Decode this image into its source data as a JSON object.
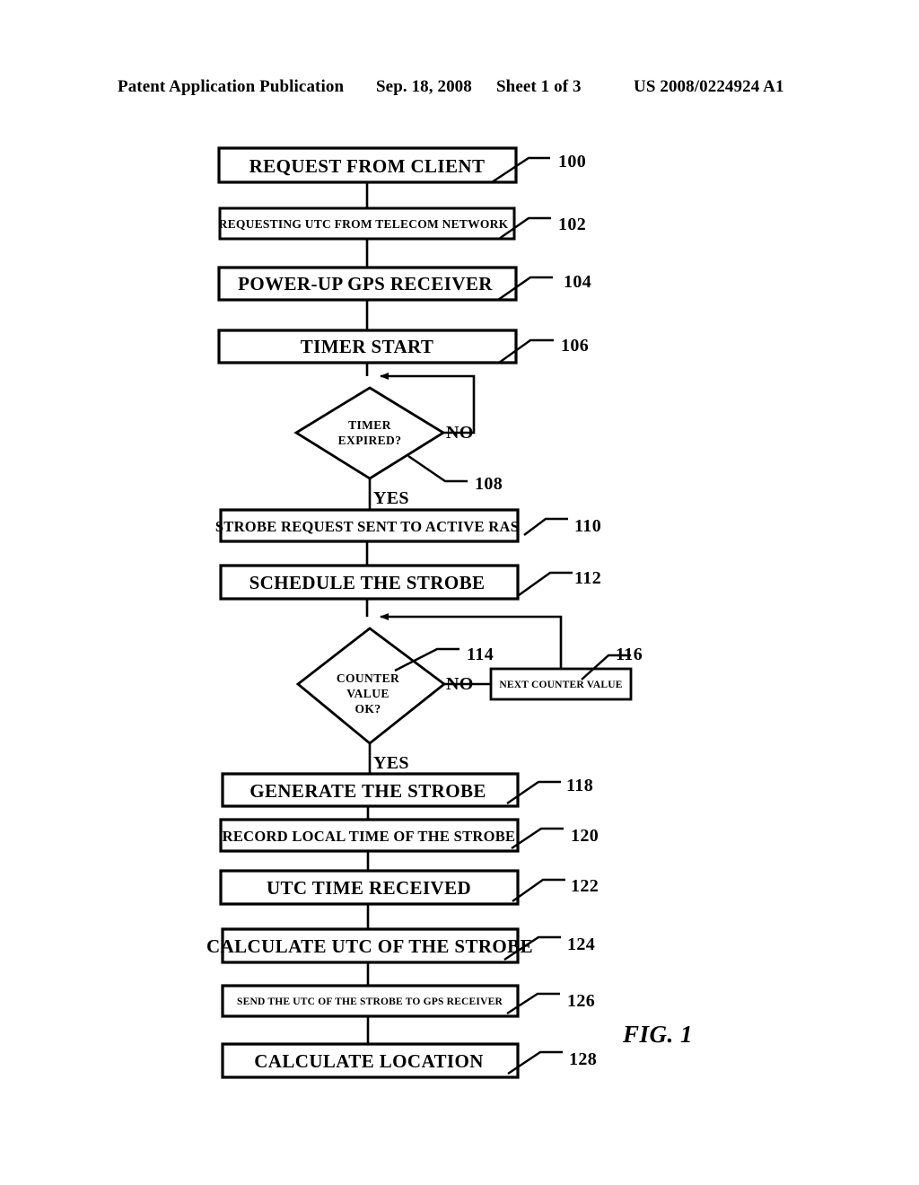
{
  "header": {
    "publication": "Patent Application Publication",
    "date": "Sep. 18, 2008",
    "sheet": "Sheet 1 of 3",
    "patent_number": "US 2008/0224924 A1"
  },
  "figure": {
    "label": "FIG. 1",
    "title": "Flowchart of GPS strobe UTC timing method"
  },
  "flowchart": {
    "steps": [
      {
        "ref": "100",
        "text": "REQUEST FROM CLIENT",
        "shape": "process"
      },
      {
        "ref": "102",
        "text": "REQUESTING UTC FROM TELECOM NETWORK",
        "shape": "process"
      },
      {
        "ref": "104",
        "text": "POWER-UP GPS RECEIVER",
        "shape": "process"
      },
      {
        "ref": "106",
        "text": "TIMER START",
        "shape": "process"
      },
      {
        "ref": "108",
        "text": "TIMER EXPIRED?",
        "shape": "decision",
        "line1": "TIMER",
        "line2": "EXPIRED?"
      },
      {
        "ref": "110",
        "text": "STROBE REQUEST SENT TO ACTIVE RAS",
        "shape": "process"
      },
      {
        "ref": "112",
        "text": "SCHEDULE THE STROBE",
        "shape": "process"
      },
      {
        "ref": "114",
        "text": "COUNTER VALUE OK?",
        "shape": "decision",
        "line1": "COUNTER",
        "line2": "VALUE",
        "line3": "OK?"
      },
      {
        "ref": "116",
        "text": "NEXT COUNTER VALUE",
        "shape": "process"
      },
      {
        "ref": "118",
        "text": "GENERATE THE STROBE",
        "shape": "process"
      },
      {
        "ref": "120",
        "text": "RECORD LOCAL TIME OF THE STROBE",
        "shape": "process"
      },
      {
        "ref": "122",
        "text": "UTC TIME RECEIVED",
        "shape": "process"
      },
      {
        "ref": "124",
        "text": "CALCULATE UTC OF THE STROBE",
        "shape": "process"
      },
      {
        "ref": "126",
        "text": "SEND THE UTC OF THE STROBE TO GPS RECEIVER",
        "shape": "process"
      },
      {
        "ref": "128",
        "text": "CALCULATE LOCATION",
        "shape": "process"
      }
    ],
    "branch_labels": {
      "timer_no": "NO",
      "timer_yes": "YES",
      "counter_no": "NO",
      "counter_yes": "YES"
    }
  },
  "colors": {
    "ink": "#000000",
    "paper": "#ffffff"
  }
}
